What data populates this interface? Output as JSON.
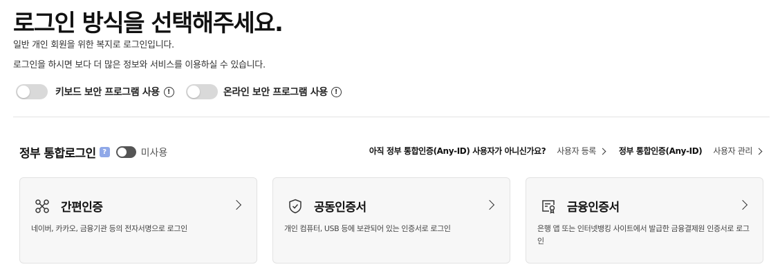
{
  "page": {
    "title": "로그인 방식을 선택해주세요.",
    "desc1": "일반 개인 회원을 위한 복지로 로그인입니다.",
    "desc2": "로그인을 하시면 보다 더 많은 정보와 서비스를 이용하실 수 있습니다."
  },
  "security": {
    "keyboard_label": "키보드 보안 프로그램 사용",
    "online_label": "온라인 보안 프로그램 사용",
    "info_glyph": "!"
  },
  "gov": {
    "title": "정부 통합로그인",
    "help_glyph": "?",
    "status": "미사용",
    "question": "아직 정부 통합인증(Any-ID) 사용자가 아니신가요?",
    "register_link": "사용자 등록",
    "any_id": "정부 통합인증(Any-ID)",
    "manage_link": "사용자 관리"
  },
  "cards": [
    {
      "title": "간편인증",
      "desc": "네이버, 카카오, 금융기관 등의 전자서명으로 로그인",
      "icon": "simple-auth-icon"
    },
    {
      "title": "공동인증서",
      "desc": "개인 컴퓨터, USB 등에 보관되어 있는 인증서로 로그인",
      "icon": "shield-check-icon"
    },
    {
      "title": "금융인증서",
      "desc": "은행 앱 또는 인터넷뱅킹 사이트에서 발급한 금융결제원 인증서로 로그인",
      "icon": "certificate-icon"
    }
  ]
}
